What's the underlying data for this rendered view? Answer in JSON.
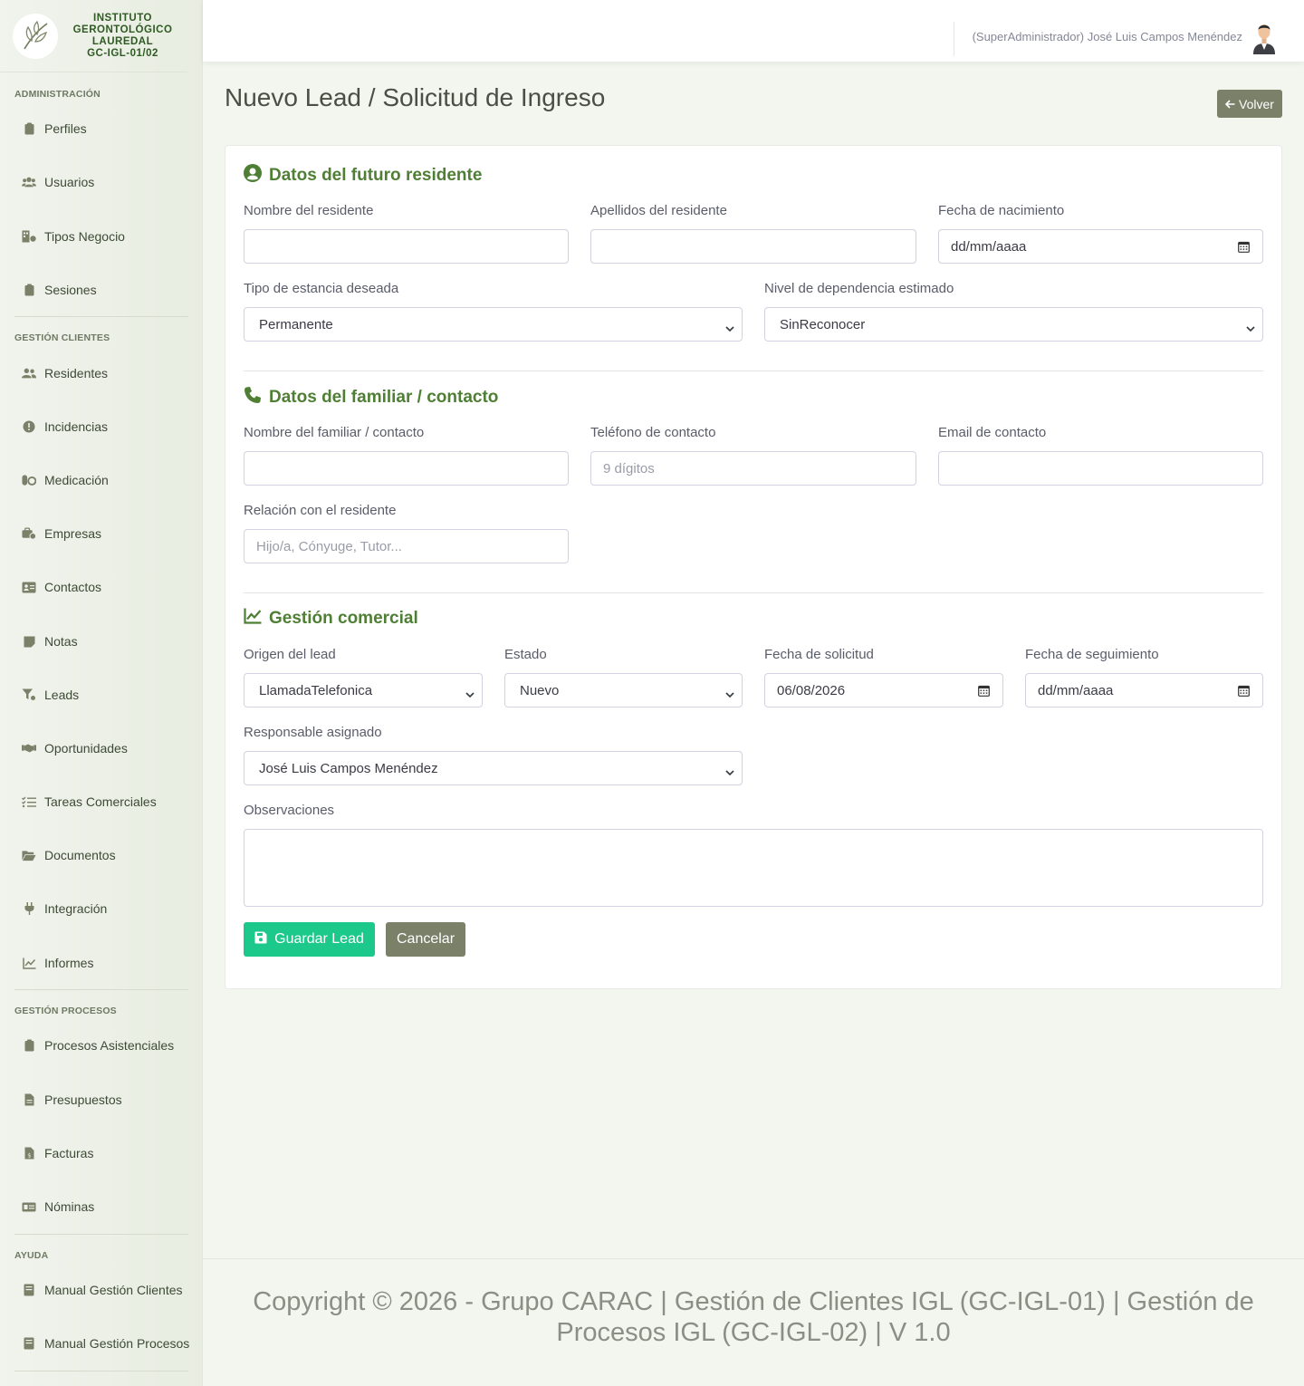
{
  "brand": {
    "line1": "INSTITUTO",
    "line2": "GERONTOLÓGICO",
    "line3": "LAUREDAL",
    "line4": "GC-IGL-01/02"
  },
  "sidebar": {
    "sections": [
      "Administración",
      "Gestión Clientes",
      "Gestión Procesos",
      "Ayuda"
    ],
    "items": [
      {
        "label": "Perfiles",
        "icon": "clipboard-icon"
      },
      {
        "label": "Usuarios",
        "icon": "users-icon"
      },
      {
        "label": "Tipos Negocio",
        "icon": "building-icon"
      },
      {
        "label": "Sesiones",
        "icon": "clipboard-icon"
      },
      {
        "label": "Residentes",
        "icon": "user-friends-icon"
      },
      {
        "label": "Incidencias",
        "icon": "exclamation-circle-icon"
      },
      {
        "label": "Medicación",
        "icon": "pills-icon"
      },
      {
        "label": "Empresas",
        "icon": "briefcase-icon"
      },
      {
        "label": "Contactos",
        "icon": "address-card-icon"
      },
      {
        "label": "Notas",
        "icon": "sticky-note-icon"
      },
      {
        "label": "Leads",
        "icon": "funnel-icon"
      },
      {
        "label": "Oportunidades",
        "icon": "handshake-icon"
      },
      {
        "label": "Tareas Comerciales",
        "icon": "tasks-icon"
      },
      {
        "label": "Documentos",
        "icon": "folder-open-icon"
      },
      {
        "label": "Integración",
        "icon": "plug-icon"
      },
      {
        "label": "Informes",
        "icon": "chart-line-icon"
      },
      {
        "label": "Procesos Asistenciales",
        "icon": "clipboard-icon"
      },
      {
        "label": "Presupuestos",
        "icon": "file-alt-icon"
      },
      {
        "label": "Facturas",
        "icon": "file-invoice-icon"
      },
      {
        "label": "Nóminas",
        "icon": "money-check-icon"
      },
      {
        "label": "Manual Gestión Clientes",
        "icon": "book-icon"
      },
      {
        "label": "Manual Gestión Procesos",
        "icon": "book-icon"
      }
    ]
  },
  "topbar": {
    "user": "(SuperAdministrador) José Luis Campos Menéndez"
  },
  "page": {
    "title": "Nuevo Lead / Solicitud de Ingreso",
    "back_button": "Volver"
  },
  "form": {
    "section1": {
      "title": "Datos del futuro residente",
      "nombre_label": "Nombre del residente",
      "nombre_value": "",
      "apellidos_label": "Apellidos del residente",
      "apellidos_value": "",
      "fecha_nac_label": "Fecha de nacimiento",
      "fecha_nac_value": "dd/mm/aaaa",
      "estancia_label": "Tipo de estancia deseada",
      "estancia_value": "Permanente",
      "dependencia_label": "Nivel de dependencia estimado",
      "dependencia_value": "SinReconocer"
    },
    "section2": {
      "title": "Datos del familiar / contacto",
      "familiar_label": "Nombre del familiar / contacto",
      "familiar_value": "",
      "telefono_label": "Teléfono de contacto",
      "telefono_placeholder": "9 dígitos",
      "email_label": "Email de contacto",
      "email_value": "",
      "relacion_label": "Relación con el residente",
      "relacion_placeholder": "Hijo/a, Cónyuge, Tutor..."
    },
    "section3": {
      "title": "Gestión comercial",
      "origen_label": "Origen del lead",
      "origen_value": "LlamadaTelefonica",
      "estado_label": "Estado",
      "estado_value": "Nuevo",
      "fecha_sol_label": "Fecha de solicitud",
      "fecha_sol_value": "06/08/2026",
      "fecha_seg_label": "Fecha de seguimiento",
      "fecha_seg_value": "dd/mm/aaaa",
      "responsable_label": "Responsable asignado",
      "responsable_value": "José Luis Campos Menéndez",
      "observaciones_label": "Observaciones",
      "observaciones_value": ""
    },
    "save_button": "Guardar Lead",
    "cancel_button": "Cancelar"
  },
  "footer": {
    "text": "Copyright © 2026 - Grupo CARAC | Gestión de Clientes IGL (GC-IGL-01) | Gestión de Procesos IGL (GC-IGL-02) | V 1.0"
  },
  "colors": {
    "accent": "#4f7f35",
    "success": "#1cc88a",
    "secondary": "#7b8069"
  }
}
